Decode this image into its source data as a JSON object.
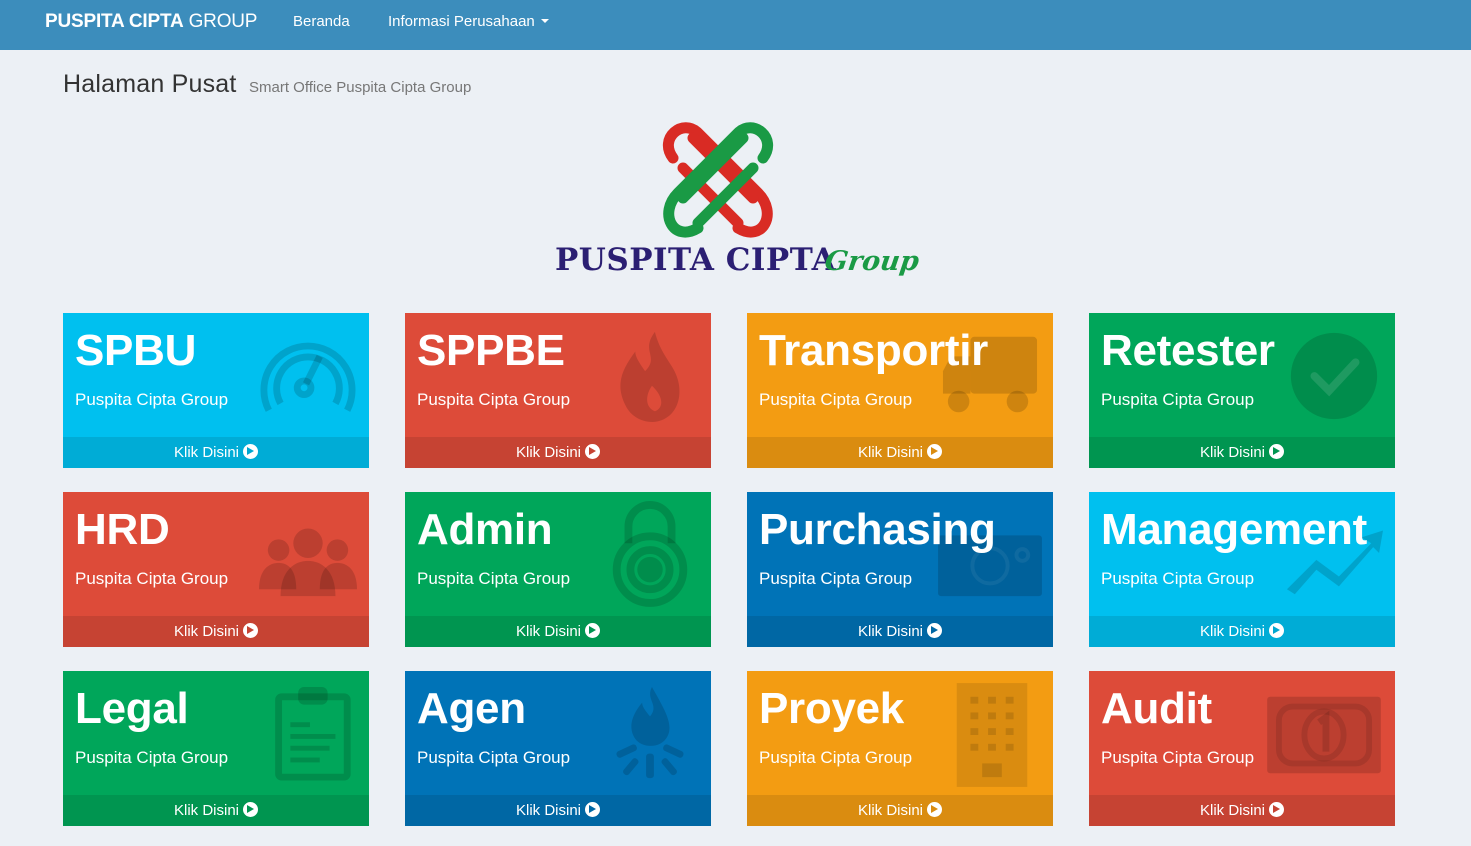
{
  "navbar": {
    "brand_bold": "PUSPITA CIPTA",
    "brand_light": "GROUP",
    "links": [
      {
        "label": "Beranda"
      },
      {
        "label": "Informasi Perusahaan"
      }
    ]
  },
  "header": {
    "title": "Halaman Pusat",
    "subtitle": "Smart Office Puspita Cipta Group"
  },
  "logo": {
    "text": "PUSPITA CIPTA",
    "script": "Group"
  },
  "colors": {
    "navbar": "#3c8dbc",
    "background": "#ecf0f5",
    "aqua": "#00c0ef",
    "red": "#dd4b39",
    "yellow": "#f39c12",
    "green": "#00a65a",
    "blue": "#0073b7",
    "logo_red": "#d92b24",
    "logo_green": "#1a9a45",
    "logo_navy": "#2b1f73"
  },
  "tiles": [
    {
      "title": "SPBU",
      "subtitle": "Puspita Cipta Group",
      "footer": "Klik Disini",
      "color": "aqua",
      "icon": "dashboard-icon"
    },
    {
      "title": "SPPBE",
      "subtitle": "Puspita Cipta Group",
      "footer": "Klik Disini",
      "color": "red",
      "icon": "fire-icon"
    },
    {
      "title": "Transportir",
      "subtitle": "Puspita Cipta Group",
      "footer": "Klik Disini",
      "color": "yellow",
      "icon": "truck-icon"
    },
    {
      "title": "Retester",
      "subtitle": "Puspita Cipta Group",
      "footer": "Klik Disini",
      "color": "green",
      "icon": "check-circle-icon"
    },
    {
      "title": "HRD",
      "subtitle": "Puspita Cipta Group",
      "footer": "Klik Disini",
      "color": "red",
      "icon": "users-icon"
    },
    {
      "title": "Admin",
      "subtitle": "Puspita Cipta Group",
      "footer": "Klik Disini",
      "color": "green",
      "icon": "lock-icon"
    },
    {
      "title": "Purchasing",
      "subtitle": "Puspita Cipta Group",
      "footer": "Klik Disini",
      "color": "blue",
      "icon": "money-icon"
    },
    {
      "title": "Management",
      "subtitle": "Puspita Cipta Group",
      "footer": "Klik Disini",
      "color": "aqua",
      "icon": "line-chart-icon"
    },
    {
      "title": "Legal",
      "subtitle": "Puspita Cipta Group",
      "footer": "Klik Disini",
      "color": "green",
      "icon": "clipboard-icon"
    },
    {
      "title": "Agen",
      "subtitle": "Puspita Cipta Group",
      "footer": "Klik Disini",
      "color": "blue",
      "icon": "gas-flame-icon"
    },
    {
      "title": "Proyek",
      "subtitle": "Puspita Cipta Group",
      "footer": "Klik Disini",
      "color": "yellow",
      "icon": "building-icon"
    },
    {
      "title": "Audit",
      "subtitle": "Puspita Cipta Group",
      "footer": "Klik Disini",
      "color": "red",
      "icon": "banknote-icon"
    }
  ]
}
